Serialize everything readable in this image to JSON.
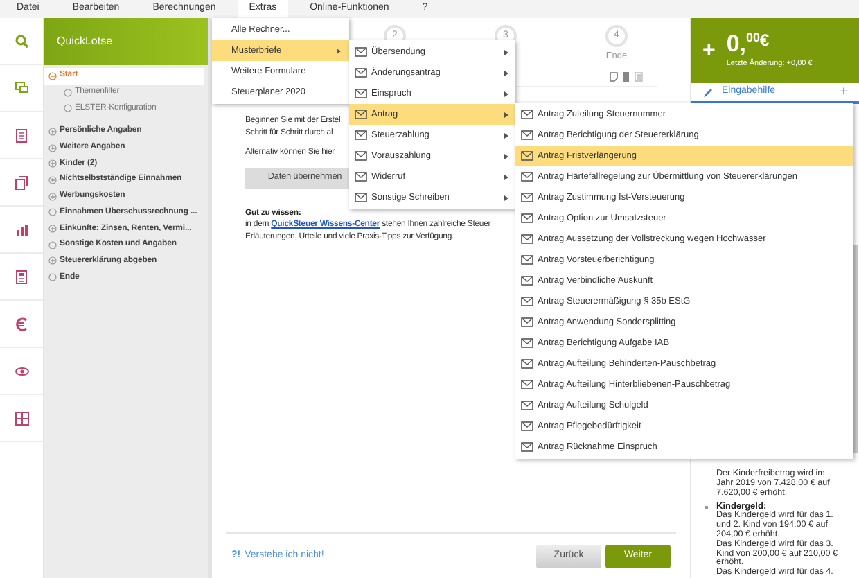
{
  "menubar": [
    {
      "label": "Datei",
      "selected": false
    },
    {
      "label": "Bearbeiten",
      "selected": false
    },
    {
      "label": "Berechnungen",
      "selected": false
    },
    {
      "label": "Extras",
      "selected": true
    },
    {
      "label": "Online-Funktionen",
      "selected": false
    },
    {
      "label": "?",
      "selected": false
    }
  ],
  "quicklotse": {
    "title": "QuickLotse",
    "tree": [
      {
        "label": "Start",
        "kind": "group",
        "expanded": true,
        "selected": true,
        "children": [
          {
            "label": "Themenfilter",
            "kind": "leaf",
            "selected": false
          },
          {
            "label": "ELSTER-Konfiguration",
            "kind": "leaf",
            "selected": false
          }
        ]
      },
      {
        "label": "Persönliche Angaben",
        "kind": "group",
        "expanded": false,
        "selected": false
      },
      {
        "label": "Weitere Angaben",
        "kind": "group",
        "expanded": false,
        "selected": false
      },
      {
        "label": "Kinder (2)",
        "kind": "group",
        "expanded": false,
        "selected": false
      },
      {
        "label": "Nichtselbstständige Einnahmen",
        "kind": "group",
        "expanded": false,
        "selected": false
      },
      {
        "label": "Werbungskosten",
        "kind": "group",
        "expanded": false,
        "selected": false
      },
      {
        "label": "Einnahmen Überschussrechnung ...",
        "kind": "leaf",
        "selected": false
      },
      {
        "label": "Einkünfte: Zinsen, Renten, Vermi...",
        "kind": "group",
        "expanded": false,
        "selected": false
      },
      {
        "label": "Sonstige Kosten und Angaben",
        "kind": "leaf",
        "selected": false
      },
      {
        "label": "Steuererklärung abgeben",
        "kind": "group",
        "expanded": false,
        "selected": false
      },
      {
        "label": "Ende",
        "kind": "leaf",
        "selected": false
      }
    ]
  },
  "stepper": [
    {
      "number": "2"
    },
    {
      "number": "3"
    },
    {
      "number": "4",
      "label": "Ende"
    }
  ],
  "content": {
    "intro": [
      "Beginnen Sie mit der Erstel",
      "Schritt für Schritt durch al"
    ],
    "alternative": "Alternativ können Sie hier",
    "button": "Daten übernehmen",
    "tip_title": "Gut zu wissen:",
    "tip_prefix": "in dem ",
    "tip_link": "QuickSteuer Wissens-Center",
    "tip_suffix": " stehen Ihnen zahlreiche Steuer",
    "tip_line2": "Erläuterungen, Urteile und viele Praxis-Tipps zur Verfügung."
  },
  "footer": {
    "help_icon": "?!",
    "help_link": "Verstehe ich nicht!",
    "back": "Zurück",
    "next": "Weiter"
  },
  "summary": {
    "sign": "+",
    "amount": "0,",
    "cents": "00",
    "currency": "€",
    "last_change": "Letzte Änderung: +0,00 €"
  },
  "help_panel": {
    "tab": "Eingabehilfe",
    "add": "+",
    "items": [
      {
        "bullet": false,
        "paragraphs": [
          "Der Kinderfreibetrag wird im Jahr 2019 von 7.428,00 € auf 7.620,00 € erhöht."
        ]
      },
      {
        "bullet": true,
        "title": "Kindergeld:",
        "paragraphs": [
          "Das Kindergeld wird für das 1. und 2. Kind von 194,00 € auf 204,00 € erhöht.",
          "Das Kindergeld wird für das 3. Kind von 200,00 € auf 210,00 € erhöht.",
          "Das Kindergeld wird für das 4."
        ]
      }
    ]
  },
  "menus": {
    "extras": [
      {
        "label": "Alle Rechner...",
        "selected": false,
        "submenu": false
      },
      {
        "label": "Musterbriefe",
        "selected": true,
        "submenu": true
      },
      {
        "label": "Weitere Formulare",
        "selected": false,
        "submenu": false
      },
      {
        "label": "Steuerplaner 2020",
        "selected": false,
        "submenu": false
      }
    ],
    "musterbriefe": [
      {
        "label": "Übersendung",
        "selected": false
      },
      {
        "label": "Änderungsantrag",
        "selected": false
      },
      {
        "label": "Einspruch",
        "selected": false
      },
      {
        "label": "Antrag",
        "selected": true
      },
      {
        "label": "Steuerzahlung",
        "selected": false
      },
      {
        "label": "Vorauszahlung",
        "selected": false
      },
      {
        "label": "Widerruf",
        "selected": false
      },
      {
        "label": "Sonstige Schreiben",
        "selected": false
      }
    ],
    "antrag": [
      {
        "label": "Antrag Zuteilung Steuernummer",
        "selected": false
      },
      {
        "label": "Antrag Berichtigung der Steuererklärung",
        "selected": false
      },
      {
        "label": "Antrag Fristverlängerung",
        "selected": true
      },
      {
        "label": "Antrag Härtefallregelung zur Übermittlung von Steuererklärungen",
        "selected": false
      },
      {
        "label": "Antrag Zustimmung Ist-Versteuerung",
        "selected": false
      },
      {
        "label": "Antrag Option zur Umsatzsteuer",
        "selected": false
      },
      {
        "label": "Antrag Aussetzung der Vollstreckung wegen Hochwasser",
        "selected": false
      },
      {
        "label": "Antrag Vorsteuerberichtigung",
        "selected": false
      },
      {
        "label": "Antrag Verbindliche Auskunft",
        "selected": false
      },
      {
        "label": "Antrag Steuerermäßigung § 35b EStG",
        "selected": false
      },
      {
        "label": "Antrag Anwendung Sondersplitting",
        "selected": false
      },
      {
        "label": "Antrag Berichtigung Aufgabe IAB",
        "selected": false
      },
      {
        "label": "Antrag Aufteilung Behinderten-Pauschbetrag",
        "selected": false
      },
      {
        "label": "Antrag Aufteilung Hinterbliebenen-Pauschbetrag",
        "selected": false
      },
      {
        "label": "Antrag Aufteilung Schulgeld",
        "selected": false
      },
      {
        "label": "Antrag Pflegebedürftigkeit",
        "selected": false
      },
      {
        "label": "Antrag Rücknahme Einspruch",
        "selected": false
      }
    ]
  }
}
